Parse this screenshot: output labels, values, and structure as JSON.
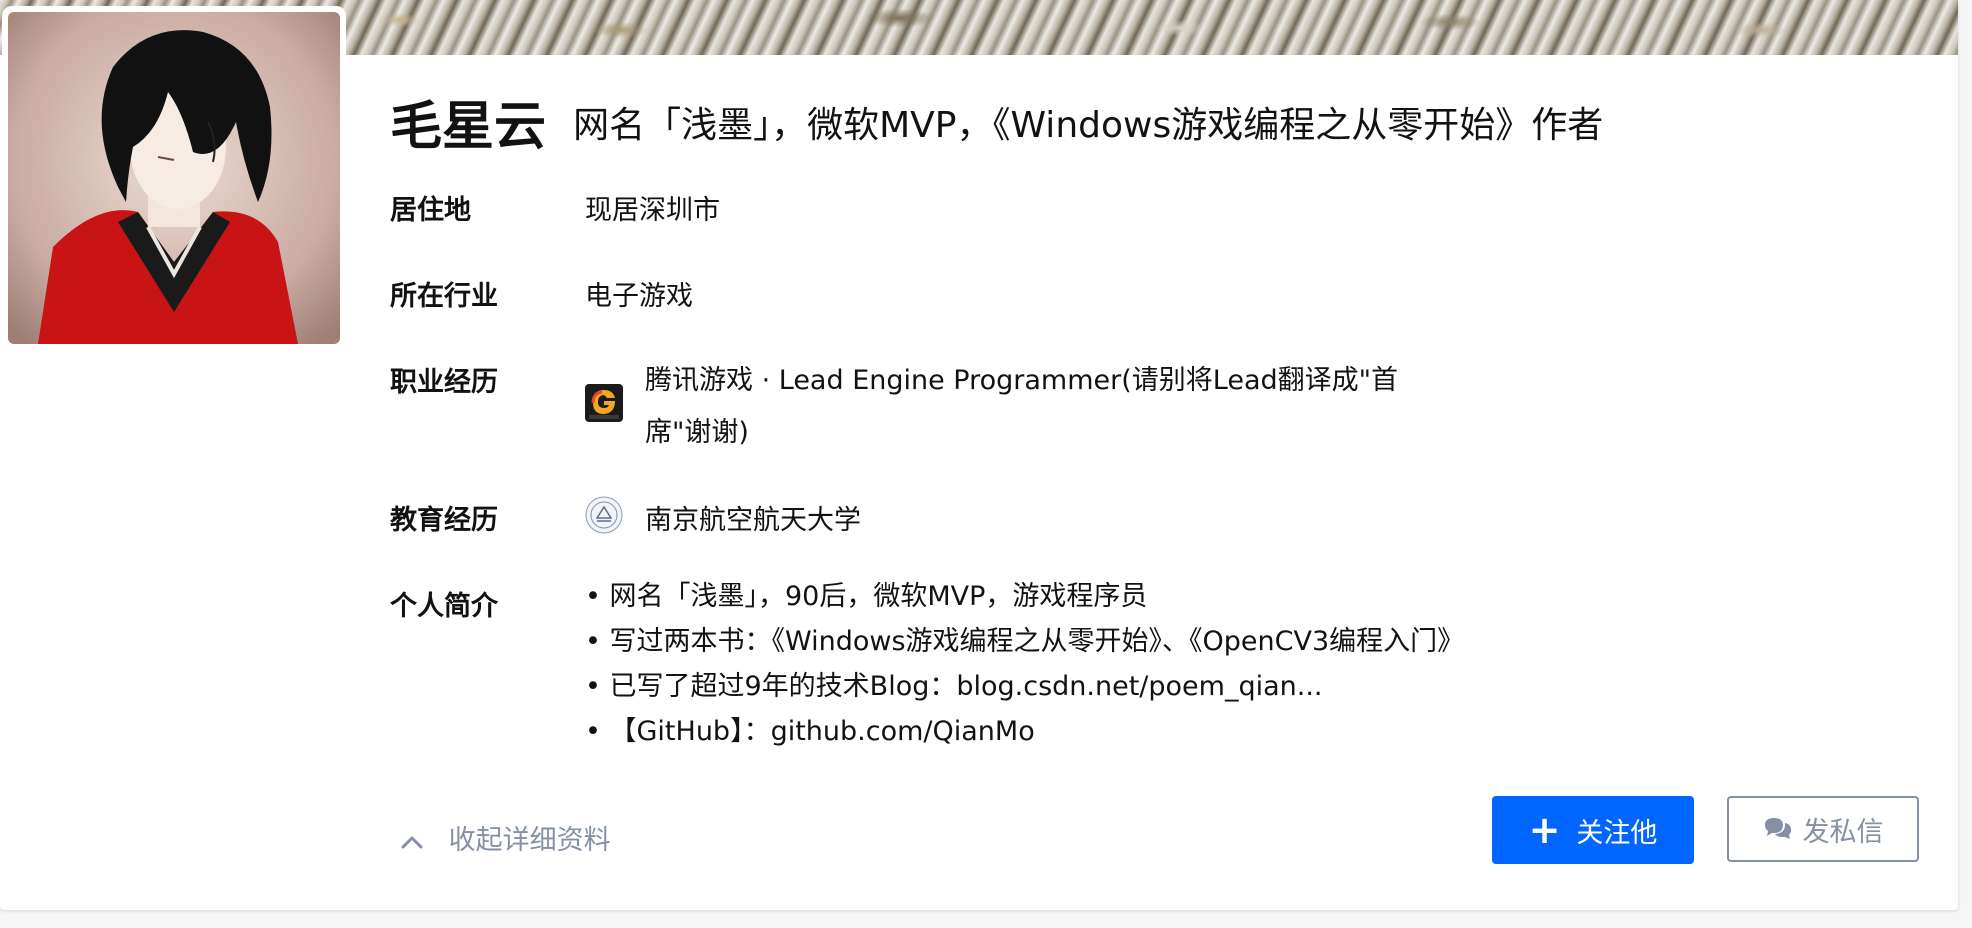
{
  "profile": {
    "name": "毛星云",
    "headline": "网名「浅墨」，微软MVP，《Windows游戏编程之从零开始》作者"
  },
  "fields": {
    "residence_label": "居住地",
    "residence_value": "现居深圳市",
    "industry_label": "所在行业",
    "industry_value": "电子游戏",
    "career_label": "职业经历",
    "career_value": "腾讯游戏 · Lead Engine Programmer(请别将Lead翻译成\"首席\"谢谢)",
    "education_label": "教育经历",
    "education_value": "南京航空航天大学",
    "bio_label": "个人简介"
  },
  "bio_lines": [
    "• 网名「浅墨」，90后，微软MVP，游戏程序员",
    "• 写过两本书：《Windows游戏编程之从零开始》、《OpenCV3编程入门》",
    "• 已写了超过9年的技术Blog：blog.csdn.net/poem_qian...",
    "• 【GitHub】：github.com/QianMo"
  ],
  "actions": {
    "collapse_label": "收起详细资料",
    "follow_label": "关注他",
    "message_label": "发私信"
  },
  "icons": {
    "avatar": "anime-avatar-image",
    "company_logo": "tencent-games-logo",
    "school_logo": "nuaa-school-logo",
    "collapse": "chevron-up-icon",
    "follow": "plus-icon",
    "message": "chat-bubbles-icon"
  },
  "colors": {
    "primary": "#0066ff",
    "muted": "#8590a6",
    "text": "#121212"
  }
}
